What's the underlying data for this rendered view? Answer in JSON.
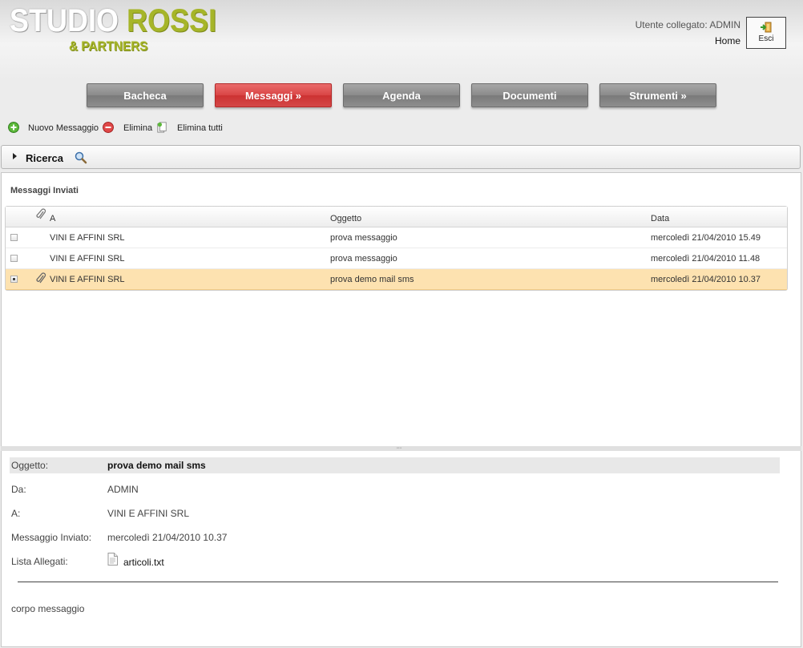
{
  "header": {
    "logo_main_white": "STUDIO",
    "logo_main_green": "ROSSI",
    "logo_sub": "& PARTNERS",
    "user_label": "Utente collegato: ADMIN",
    "home_link": "Home",
    "exit_label": "Esci"
  },
  "nav": {
    "items": [
      {
        "label": "Bacheca"
      },
      {
        "label": "Messaggi »"
      },
      {
        "label": "Agenda"
      },
      {
        "label": "Documenti"
      },
      {
        "label": "Strumenti »"
      }
    ],
    "active": "Messaggi »"
  },
  "toolbar": {
    "new_message": "Nuovo Messaggio",
    "delete": "Elimina",
    "delete_all": "Elimina tutti"
  },
  "search": {
    "label": "Ricerca"
  },
  "messages": {
    "title": "Messaggi Inviati",
    "columns": [
      "A",
      "Oggetto",
      "Data"
    ],
    "rows": [
      {
        "to": "VINI E AFFINI SRL",
        "subject": "prova messaggio",
        "date": "mercoledì 21/04/2010 15.49",
        "attachment": false,
        "checked": false,
        "selected": false
      },
      {
        "to": "VINI E AFFINI SRL",
        "subject": "prova messaggio",
        "date": "mercoledì 21/04/2010 11.48",
        "attachment": false,
        "checked": false,
        "selected": false
      },
      {
        "to": "VINI E AFFINI SRL",
        "subject": "prova demo mail sms",
        "date": "mercoledì 21/04/2010 10.37",
        "attachment": true,
        "checked": true,
        "selected": true
      }
    ]
  },
  "detail": {
    "subject_label": "Oggetto:",
    "subject_value": "prova demo mail sms",
    "from_label": "Da:",
    "from_value": "ADMIN",
    "to_label": "A:",
    "to_value": "VINI E AFFINI SRL",
    "sent_label": "Messaggio Inviato:",
    "sent_value": "mercoledì 21/04/2010 10.37",
    "attachments_label": "Lista Allegati:",
    "attachment_file": "articoli.txt",
    "body": "corpo messaggio"
  },
  "colors": {
    "logo_green": "#a6b529",
    "nav_active": "#d94545",
    "nav_default": "#8a8a8a",
    "row_selected": "#fde2b0"
  }
}
